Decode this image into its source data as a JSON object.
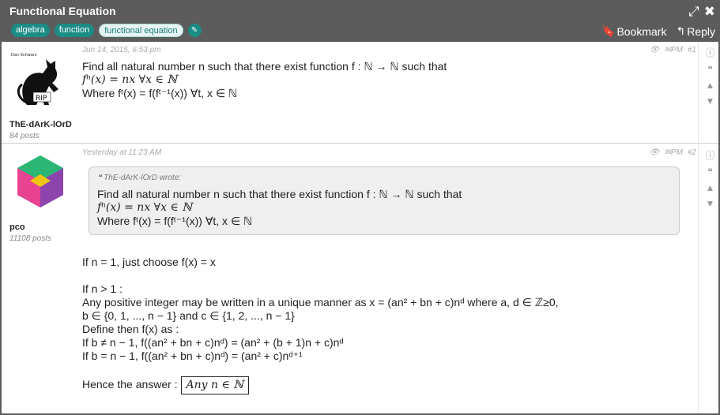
{
  "header": {
    "title": "Functional Equation",
    "tags": [
      "algebra",
      "function",
      "functional equation"
    ],
    "edit_icon": "pencil-icon",
    "bookmark_label": "Bookmark",
    "reply_label": "Reply"
  },
  "posts": [
    {
      "user": "ThE-dArK-lOrD",
      "avatar_caption_top": "Dan Schwarz",
      "avatar_caption_bottom": "RIP",
      "post_count": "84 posts",
      "date": "Jun 14, 2015, 6:53 pm",
      "pm_label": "PM",
      "post_number": "#1",
      "lines": [
        "Find all natural number n such that there exist function f : ℕ → ℕ such that",
        "fⁿ(x) = nx ∀x ∈ ℕ",
        "Where fᵗ(x) = f(fᵗ⁻¹(x)) ∀t, x ∈ ℕ"
      ]
    },
    {
      "user": "pco",
      "post_count": "11108 posts",
      "date": "Yesterday at 11:23 AM",
      "pm_label": "PM",
      "post_number": "#2",
      "quote_author": "ThE-dArK-lOrD wrote:",
      "quote_lines": [
        "Find all natural number n such that there exist function f : ℕ → ℕ such that",
        "fⁿ(x) = nx ∀x ∈ ℕ",
        "Where fᵗ(x) = f(fᵗ⁻¹(x)) ∀t, x ∈ ℕ"
      ],
      "answer_lines": [
        "If n = 1, just choose f(x) = x",
        "",
        "If n > 1 :",
        "Any positive integer may be written in a unique manner as x = (an² + bn + c)nᵈ where a, d ∈ ℤ≥0,",
        "b ∈ {0, 1, ..., n − 1} and c ∈ {1, 2, ..., n − 1}",
        "Define then f(x) as :",
        "If b ≠ n − 1, f((an² + bn + c)nᵈ) = (an² + (b + 1)n + c)nᵈ",
        "If b = n − 1, f((an² + bn + c)nᵈ) = (an² + c)nᵈ⁺¹",
        ""
      ],
      "final_label": "Hence the answer :",
      "final_answer": "Any n ∈ ℕ"
    }
  ]
}
